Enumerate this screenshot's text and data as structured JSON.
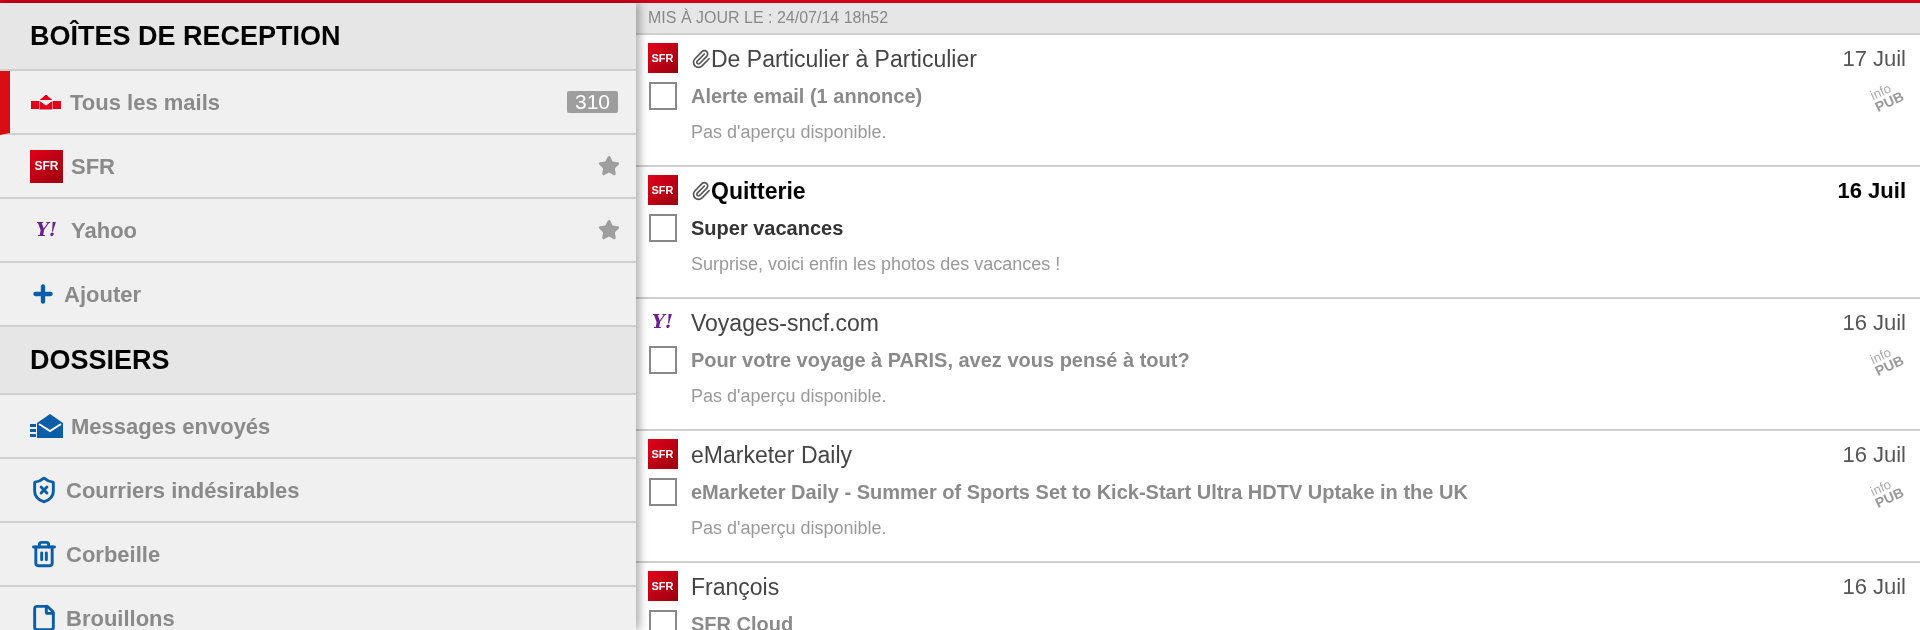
{
  "sidebar": {
    "sections": [
      {
        "title": "BOÎTES DE RECEPTION",
        "items": [
          {
            "kind": "all",
            "label": "Tous les mails",
            "selected": true,
            "count": "310",
            "starred": false
          },
          {
            "kind": "sfr",
            "logo": "SFR",
            "label": "SFR",
            "selected": false,
            "starred": true
          },
          {
            "kind": "yahoo",
            "logo": "Y!",
            "label": "Yahoo",
            "selected": false,
            "starred": true
          },
          {
            "kind": "add",
            "label": "Ajouter",
            "selected": false,
            "starred": false
          }
        ]
      },
      {
        "title": "DOSSIERS",
        "items": [
          {
            "kind": "sent",
            "label": "Messages envoyés",
            "selected": false,
            "starred": false
          },
          {
            "kind": "spam",
            "label": "Courriers indésirables",
            "selected": false,
            "starred": false
          },
          {
            "kind": "trash",
            "label": "Corbeille",
            "selected": false,
            "starred": false
          },
          {
            "kind": "drafts",
            "label": "Brouillons",
            "selected": false,
            "starred": false
          }
        ]
      }
    ]
  },
  "mail_list": {
    "updated": "MIS À JOUR LE : 24/07/14 18h52",
    "mails": [
      {
        "kind": "sfr",
        "logo": "SFR",
        "attachment": true,
        "unread": false,
        "checked": false,
        "sender": "De Particulier à Particulier",
        "subject": "Alerte email (1 annonce)",
        "preview": "Pas d'aperçu disponible.",
        "date": "17 Juil",
        "ad": [
          "info",
          "PUB"
        ]
      },
      {
        "kind": "sfr",
        "logo": "SFR",
        "attachment": true,
        "unread": true,
        "checked": false,
        "sender": "Quitterie",
        "subject": "Super vacances",
        "preview": "Surprise, voici enfin les photos des vacances !",
        "date": "16 Juil"
      },
      {
        "kind": "yahoo",
        "logo": "Y!",
        "attachment": false,
        "unread": false,
        "checked": false,
        "sender": "Voyages-sncf.com",
        "subject": "Pour votre voyage à PARIS, avez vous pensé à tout?",
        "preview": "Pas d'aperçu disponible.",
        "date": "16 Juil",
        "ad": [
          "info",
          "PUB"
        ]
      },
      {
        "kind": "sfr",
        "logo": "SFR",
        "attachment": false,
        "unread": false,
        "checked": false,
        "sender": "eMarketer Daily",
        "subject": "eMarketer Daily - Summer of Sports Set to Kick-Start Ultra HDTV Uptake in the UK",
        "preview": "Pas d'aperçu disponible.",
        "date": "16 Juil",
        "ad": [
          "info",
          "PUB"
        ]
      },
      {
        "kind": "sfr",
        "logo": "SFR",
        "attachment": false,
        "unread": false,
        "checked": false,
        "sender": "François",
        "subject": "SFR Cloud",
        "date": "16 Juil"
      }
    ]
  }
}
